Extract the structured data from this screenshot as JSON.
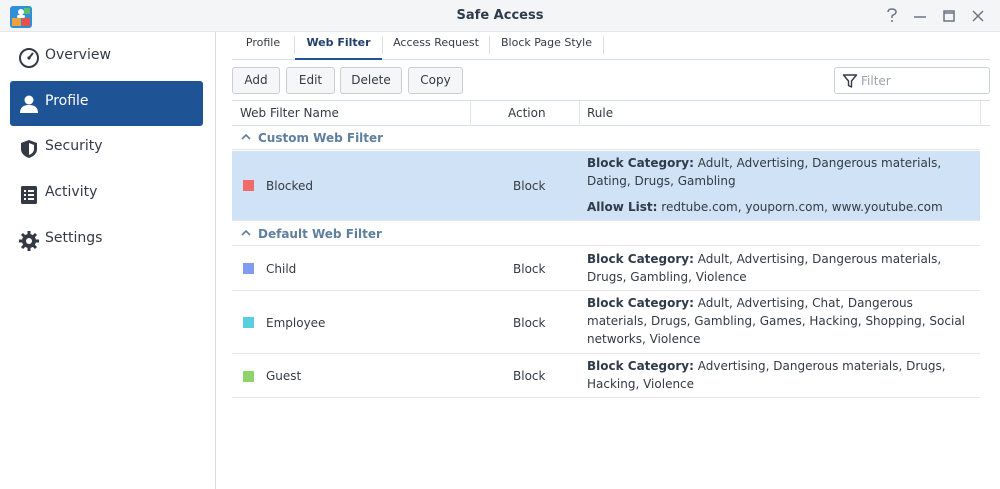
{
  "window": {
    "title": "Safe Access",
    "controls": [
      "help-icon",
      "minimize-icon",
      "maximize-icon",
      "close-icon"
    ]
  },
  "sidebar": {
    "items": [
      {
        "label": "Overview",
        "icon": "gauge-icon",
        "active": false
      },
      {
        "label": "Profile",
        "icon": "user-icon",
        "active": true
      },
      {
        "label": "Security",
        "icon": "shield-icon",
        "active": false
      },
      {
        "label": "Activity",
        "icon": "list-icon",
        "active": false
      },
      {
        "label": "Settings",
        "icon": "gear-icon",
        "active": false
      }
    ]
  },
  "tabs": [
    {
      "label": "Profile",
      "active": false
    },
    {
      "label": "Web Filter",
      "active": true
    },
    {
      "label": "Access Request",
      "active": false
    },
    {
      "label": "Block Page Style",
      "active": false
    }
  ],
  "toolbar": {
    "add_label": "Add",
    "edit_label": "Edit",
    "delete_label": "Delete",
    "copy_label": "Copy",
    "filter_placeholder": "Filter"
  },
  "grid": {
    "columns": {
      "name": "Web Filter Name",
      "action": "Action",
      "rule": "Rule"
    },
    "groups": [
      {
        "label": "Custom Web Filter",
        "rows": [
          {
            "name": "Blocked",
            "color": "#f26b6b",
            "action": "Block",
            "selected": true,
            "rule_label": "Block Category:",
            "rule_text": "Adult, Advertising, Dangerous materials, Dating, Drugs, Gambling",
            "allow_label": "Allow List:",
            "allow_text": "redtube.com, youporn.com, www.youtube.com"
          }
        ]
      },
      {
        "label": "Default Web Filter",
        "rows": [
          {
            "name": "Child",
            "color": "#7f9cf0",
            "action": "Block",
            "selected": false,
            "rule_label": "Block Category:",
            "rule_text": "Adult, Advertising, Dangerous materials, Drugs, Gambling, Violence"
          },
          {
            "name": "Employee",
            "color": "#56d0e0",
            "action": "Block",
            "selected": false,
            "rule_label": "Block Category:",
            "rule_text": "Adult, Advertising, Chat, Dangerous materials, Drugs, Gambling, Games, Hacking, Shopping, Social networks, Violence"
          },
          {
            "name": "Guest",
            "color": "#8fd46a",
            "action": "Block",
            "selected": false,
            "rule_label": "Block Category:",
            "rule_text": "Advertising, Dangerous materials, Drugs, Hacking, Violence"
          }
        ]
      }
    ]
  }
}
